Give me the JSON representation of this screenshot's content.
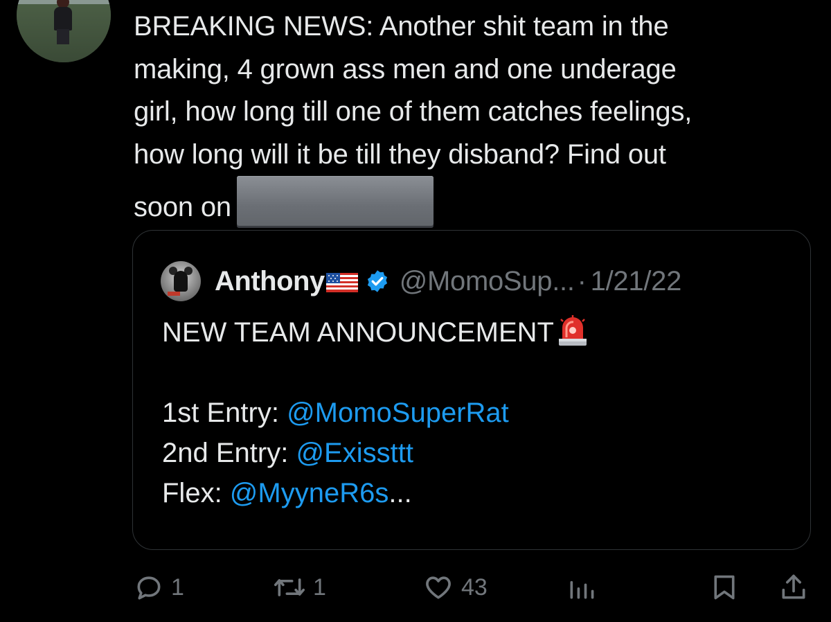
{
  "tweet": {
    "lines": [
      "BREAKING NEWS: Another shit team in the",
      "making, 4 grown ass men and one underage",
      "girl, how long till one of them catches feelings,",
      "how long will it be till they disband? Find out",
      "soon on"
    ]
  },
  "quote": {
    "name": "Anthony",
    "handle": "@MomoSup...",
    "separator": "·",
    "date": "1/21/22",
    "title": "NEW TEAM ANNOUNCEMENT",
    "entries": [
      {
        "label": "1st Entry: ",
        "mention": "@MomoSuperRat"
      },
      {
        "label": "2nd Entry: ",
        "mention": "@Exissttt"
      },
      {
        "label": "Flex: ",
        "mention": "@MyyneR6s",
        "suffix": "..."
      }
    ]
  },
  "actions": {
    "replies": "1",
    "retweets": "1",
    "likes": "43"
  },
  "colors": {
    "background": "#000000",
    "text": "#e7e9ea",
    "muted": "#71767b",
    "link": "#1d9bf0",
    "border": "#2f3336"
  },
  "icons": [
    "reply-icon",
    "retweet-icon",
    "like-icon",
    "views-icon",
    "bookmark-icon",
    "share-icon",
    "verified-icon",
    "us-flag-icon",
    "siren-icon"
  ]
}
